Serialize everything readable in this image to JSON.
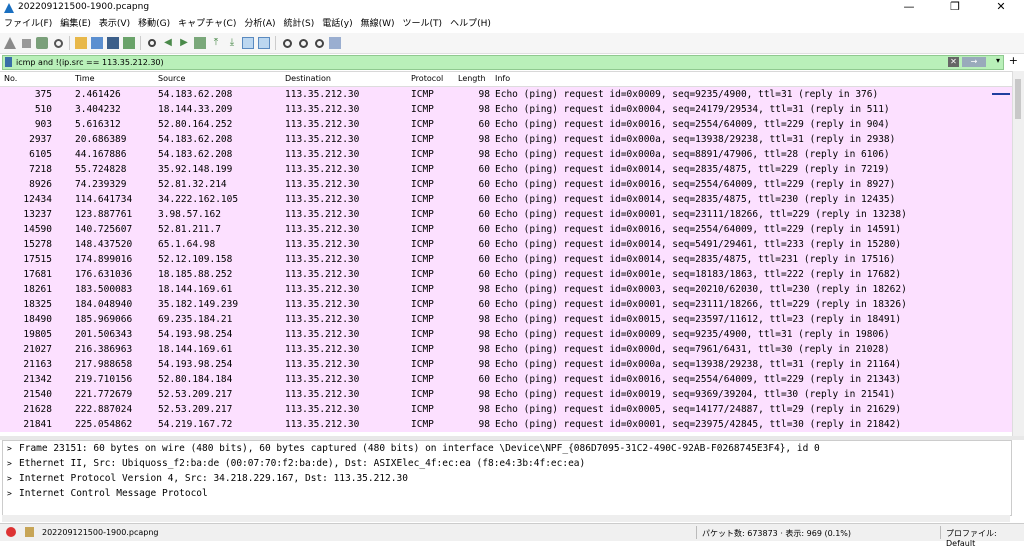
{
  "window": {
    "title": "202209121500-1900.pcapng",
    "minimize": "—",
    "maximize": "❐",
    "close": "✕"
  },
  "menu": [
    "ファイル(F)",
    "編集(E)",
    "表示(V)",
    "移動(G)",
    "キャプチャ(C)",
    "分析(A)",
    "統計(S)",
    "電話(y)",
    "無線(W)",
    "ツール(T)",
    "ヘルプ(H)"
  ],
  "filter": {
    "value": "icmp and !(ip.src == 113.35.212.30)",
    "clear": "✕",
    "apply": "→",
    "dropdown": "▾",
    "add": "+"
  },
  "columns": {
    "no": "No.",
    "time": "Time",
    "source": "Source",
    "destination": "Destination",
    "protocol": "Protocol",
    "length": "Length",
    "info": "Info"
  },
  "packets": [
    {
      "no": "375",
      "time": "2.461426",
      "src": "54.183.62.208",
      "dst": "113.35.212.30",
      "proto": "ICMP",
      "len": "98",
      "info": "Echo (ping) request  id=0x0009, seq=9235/4900, ttl=31 (reply in 376)"
    },
    {
      "no": "510",
      "time": "3.404232",
      "src": "18.144.33.209",
      "dst": "113.35.212.30",
      "proto": "ICMP",
      "len": "98",
      "info": "Echo (ping) request  id=0x0004, seq=24179/29534, ttl=31 (reply in 511)"
    },
    {
      "no": "903",
      "time": "5.616312",
      "src": "52.80.164.252",
      "dst": "113.35.212.30",
      "proto": "ICMP",
      "len": "60",
      "info": "Echo (ping) request  id=0x0016, seq=2554/64009, ttl=229 (reply in 904)"
    },
    {
      "no": "2937",
      "time": "20.686389",
      "src": "54.183.62.208",
      "dst": "113.35.212.30",
      "proto": "ICMP",
      "len": "98",
      "info": "Echo (ping) request  id=0x000a, seq=13938/29238, ttl=31 (reply in 2938)"
    },
    {
      "no": "6105",
      "time": "44.167886",
      "src": "54.183.62.208",
      "dst": "113.35.212.30",
      "proto": "ICMP",
      "len": "98",
      "info": "Echo (ping) request  id=0x000a, seq=8891/47906, ttl=28 (reply in 6106)"
    },
    {
      "no": "7218",
      "time": "55.724828",
      "src": "35.92.148.199",
      "dst": "113.35.212.30",
      "proto": "ICMP",
      "len": "60",
      "info": "Echo (ping) request  id=0x0014, seq=2835/4875, ttl=229 (reply in 7219)"
    },
    {
      "no": "8926",
      "time": "74.239329",
      "src": "52.81.32.214",
      "dst": "113.35.212.30",
      "proto": "ICMP",
      "len": "60",
      "info": "Echo (ping) request  id=0x0016, seq=2554/64009, ttl=229 (reply in 8927)"
    },
    {
      "no": "12434",
      "time": "114.641734",
      "src": "34.222.162.105",
      "dst": "113.35.212.30",
      "proto": "ICMP",
      "len": "60",
      "info": "Echo (ping) request  id=0x0014, seq=2835/4875, ttl=230 (reply in 12435)"
    },
    {
      "no": "13237",
      "time": "123.887761",
      "src": "3.98.57.162",
      "dst": "113.35.212.30",
      "proto": "ICMP",
      "len": "60",
      "info": "Echo (ping) request  id=0x0001, seq=23111/18266, ttl=229 (reply in 13238)"
    },
    {
      "no": "14590",
      "time": "140.725607",
      "src": "52.81.211.7",
      "dst": "113.35.212.30",
      "proto": "ICMP",
      "len": "60",
      "info": "Echo (ping) request  id=0x0016, seq=2554/64009, ttl=229 (reply in 14591)"
    },
    {
      "no": "15278",
      "time": "148.437520",
      "src": "65.1.64.98",
      "dst": "113.35.212.30",
      "proto": "ICMP",
      "len": "60",
      "info": "Echo (ping) request  id=0x0014, seq=5491/29461, ttl=233 (reply in 15280)"
    },
    {
      "no": "17515",
      "time": "174.899016",
      "src": "52.12.109.158",
      "dst": "113.35.212.30",
      "proto": "ICMP",
      "len": "60",
      "info": "Echo (ping) request  id=0x0014, seq=2835/4875, ttl=231 (reply in 17516)"
    },
    {
      "no": "17681",
      "time": "176.631036",
      "src": "18.185.88.252",
      "dst": "113.35.212.30",
      "proto": "ICMP",
      "len": "60",
      "info": "Echo (ping) request  id=0x001e, seq=18183/1863, ttl=222 (reply in 17682)"
    },
    {
      "no": "18261",
      "time": "183.500083",
      "src": "18.144.169.61",
      "dst": "113.35.212.30",
      "proto": "ICMP",
      "len": "98",
      "info": "Echo (ping) request  id=0x0003, seq=20210/62030, ttl=230 (reply in 18262)"
    },
    {
      "no": "18325",
      "time": "184.048940",
      "src": "35.182.149.239",
      "dst": "113.35.212.30",
      "proto": "ICMP",
      "len": "60",
      "info": "Echo (ping) request  id=0x0001, seq=23111/18266, ttl=229 (reply in 18326)"
    },
    {
      "no": "18490",
      "time": "185.969066",
      "src": "69.235.184.21",
      "dst": "113.35.212.30",
      "proto": "ICMP",
      "len": "98",
      "info": "Echo (ping) request  id=0x0015, seq=23597/11612, ttl=23 (reply in 18491)"
    },
    {
      "no": "19805",
      "time": "201.506343",
      "src": "54.193.98.254",
      "dst": "113.35.212.30",
      "proto": "ICMP",
      "len": "98",
      "info": "Echo (ping) request  id=0x0009, seq=9235/4900, ttl=31 (reply in 19806)"
    },
    {
      "no": "21027",
      "time": "216.386963",
      "src": "18.144.169.61",
      "dst": "113.35.212.30",
      "proto": "ICMP",
      "len": "98",
      "info": "Echo (ping) request  id=0x000d, seq=7961/6431, ttl=30 (reply in 21028)"
    },
    {
      "no": "21163",
      "time": "217.988658",
      "src": "54.193.98.254",
      "dst": "113.35.212.30",
      "proto": "ICMP",
      "len": "98",
      "info": "Echo (ping) request  id=0x000a, seq=13938/29238, ttl=31 (reply in 21164)"
    },
    {
      "no": "21342",
      "time": "219.710156",
      "src": "52.80.184.184",
      "dst": "113.35.212.30",
      "proto": "ICMP",
      "len": "60",
      "info": "Echo (ping) request  id=0x0016, seq=2554/64009, ttl=229 (reply in 21343)"
    },
    {
      "no": "21540",
      "time": "221.772679",
      "src": "52.53.209.217",
      "dst": "113.35.212.30",
      "proto": "ICMP",
      "len": "98",
      "info": "Echo (ping) request  id=0x0019, seq=9369/39204, ttl=30 (reply in 21541)"
    },
    {
      "no": "21628",
      "time": "222.887024",
      "src": "52.53.209.217",
      "dst": "113.35.212.30",
      "proto": "ICMP",
      "len": "98",
      "info": "Echo (ping) request  id=0x0005, seq=14177/24887, ttl=29 (reply in 21629)"
    },
    {
      "no": "21841",
      "time": "225.054862",
      "src": "54.219.167.72",
      "dst": "113.35.212.30",
      "proto": "ICMP",
      "len": "98",
      "info": "Echo (ping) request  id=0x0001, seq=23975/42845, ttl=30 (reply in 21842)"
    }
  ],
  "details": [
    "Frame 23151: 60 bytes on wire (480 bits), 60 bytes captured (480 bits) on interface \\Device\\NPF_{086D7095-31C2-490C-92AB-F0268745E3F4}, id 0",
    "Ethernet II, Src: Ubiquoss_f2:ba:de (00:07:70:f2:ba:de), Dst: ASIXElec_4f:ec:ea (f8:e4:3b:4f:ec:ea)",
    "Internet Protocol Version 4, Src: 34.218.229.167, Dst: 113.35.212.30",
    "Internet Control Message Protocol"
  ],
  "status": {
    "file": "202209121500-1900.pcapng",
    "packets": "パケット数: 673873 · 表示: 969 (0.1%)",
    "profile": "プロファイル: Default"
  },
  "colors": {
    "row_bg": "#fce0ff",
    "filter_bg": "#b9f0b9"
  }
}
